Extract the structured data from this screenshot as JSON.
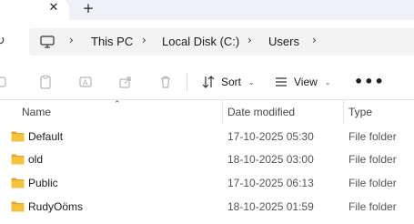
{
  "tabbar": {
    "close_glyph": "✕",
    "new_tab_glyph": "+"
  },
  "address": {
    "refresh_glyph": "↻",
    "breadcrumbs": [
      "This PC",
      "Local Disk (C:)",
      "Users"
    ],
    "separator_glyph": "›"
  },
  "toolbar": {
    "sort_label": "Sort",
    "view_label": "View",
    "more_glyph": "•••",
    "caret_glyph": "⌄"
  },
  "columns": {
    "name": "Name",
    "date_modified": "Date modified",
    "type": "Type",
    "sort_glyph": "⌃"
  },
  "files": [
    {
      "name": "Default",
      "date": "17-10-2025 05:30",
      "type": "File folder"
    },
    {
      "name": "old",
      "date": "18-10-2025 03:00",
      "type": "File folder"
    },
    {
      "name": "Public",
      "date": "17-10-2025 06:13",
      "type": "File folder"
    },
    {
      "name": "RudyOöms",
      "date": "18-10-2025 01:59",
      "type": "File folder"
    }
  ],
  "colors": {
    "folder": "#f5c23e",
    "folder_dark": "#e3a82b",
    "tabstrip": "#eef1f5",
    "address_bg": "#f3f3f3"
  }
}
